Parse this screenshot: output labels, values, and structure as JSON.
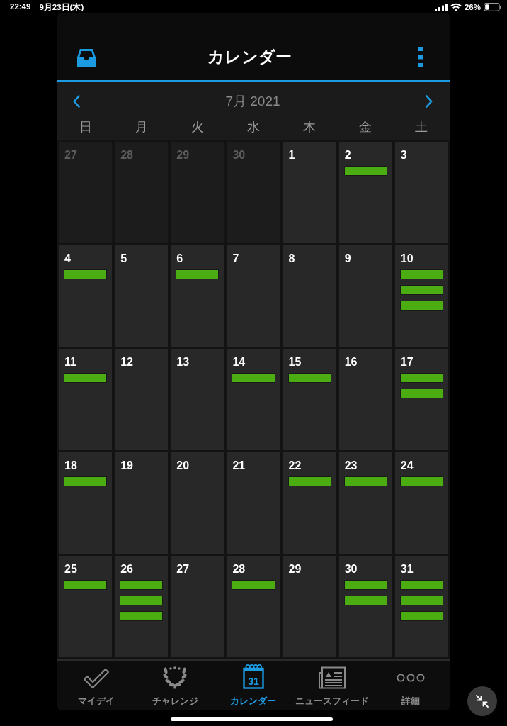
{
  "status_bar": {
    "time": "22:49",
    "date": "9月23日(木)",
    "battery": "26%"
  },
  "header": {
    "title": "カレンダー"
  },
  "month_nav": {
    "label": "7月 2021"
  },
  "weekdays": [
    "日",
    "月",
    "火",
    "水",
    "木",
    "金",
    "土"
  ],
  "days": [
    {
      "day": "27",
      "outside_month": true
    },
    {
      "day": "28",
      "outside_month": true
    },
    {
      "day": "29",
      "outside_month": true
    },
    {
      "day": "30",
      "outside_month": true
    },
    {
      "day": "1",
      "outside_month": false
    },
    {
      "day": "2",
      "outside_month": false,
      "events": [
        {
          "kind": "bar"
        }
      ]
    },
    {
      "day": "3",
      "outside_month": false
    },
    {
      "day": "4",
      "outside_month": false,
      "events": [
        {
          "kind": "bar"
        }
      ]
    },
    {
      "day": "5",
      "outside_month": false
    },
    {
      "day": "6",
      "outside_month": false,
      "events": [
        {
          "kind": "bar"
        }
      ]
    },
    {
      "day": "7",
      "outside_month": false
    },
    {
      "day": "8",
      "outside_month": false
    },
    {
      "day": "9",
      "outside_month": false
    },
    {
      "day": "10",
      "outside_month": false,
      "events": [
        {
          "kind": "bar"
        },
        {
          "kind": "bar"
        },
        {
          "kind": "bar"
        }
      ]
    },
    {
      "day": "11",
      "outside_month": false,
      "events": [
        {
          "kind": "bar"
        }
      ]
    },
    {
      "day": "12",
      "outside_month": false
    },
    {
      "day": "13",
      "outside_month": false
    },
    {
      "day": "14",
      "outside_month": false,
      "events": [
        {
          "kind": "bar"
        }
      ]
    },
    {
      "day": "15",
      "outside_month": false,
      "events": [
        {
          "kind": "bar"
        }
      ]
    },
    {
      "day": "16",
      "outside_month": false
    },
    {
      "day": "17",
      "outside_month": false,
      "events": [
        {
          "kind": "bar"
        },
        {
          "kind": "bar"
        }
      ]
    },
    {
      "day": "18",
      "outside_month": false,
      "events": [
        {
          "kind": "bar"
        }
      ]
    },
    {
      "day": "19",
      "outside_month": false
    },
    {
      "day": "20",
      "outside_month": false
    },
    {
      "day": "21",
      "outside_month": false
    },
    {
      "day": "22",
      "outside_month": false,
      "events": [
        {
          "kind": "bar"
        }
      ]
    },
    {
      "day": "23",
      "outside_month": false,
      "events": [
        {
          "kind": "bar"
        }
      ]
    },
    {
      "day": "24",
      "outside_month": false,
      "events": [
        {
          "kind": "bar"
        }
      ]
    },
    {
      "day": "25",
      "outside_month": false,
      "events": [
        {
          "kind": "bar"
        }
      ]
    },
    {
      "day": "26",
      "outside_month": false,
      "events": [
        {
          "kind": "bar"
        },
        {
          "kind": "bar"
        },
        {
          "kind": "bar"
        }
      ]
    },
    {
      "day": "27",
      "outside_month": false
    },
    {
      "day": "28",
      "outside_month": false,
      "events": [
        {
          "kind": "bar"
        }
      ]
    },
    {
      "day": "29",
      "outside_month": false
    },
    {
      "day": "30",
      "outside_month": false,
      "events": [
        {
          "kind": "bar"
        },
        {
          "kind": "bar"
        }
      ]
    },
    {
      "day": "31",
      "outside_month": false,
      "events": [
        {
          "kind": "bar"
        },
        {
          "kind": "bar"
        },
        {
          "kind": "bar"
        }
      ]
    }
  ],
  "tabs": [
    {
      "label": "マイデイ",
      "selected": false
    },
    {
      "label": "チャレンジ",
      "selected": false
    },
    {
      "label": "カレンダー",
      "selected": true,
      "icon_text": "31"
    },
    {
      "label": "ニュースフィード",
      "selected": false
    },
    {
      "label": "詳細",
      "selected": false
    }
  ]
}
